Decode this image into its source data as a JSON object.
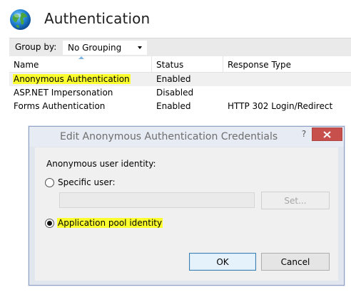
{
  "header": {
    "title": "Authentication",
    "icon": "globe-icon"
  },
  "group_by": {
    "label": "Group by:",
    "value": "No Grouping"
  },
  "list": {
    "columns": [
      "Name",
      "Status",
      "Response Type"
    ],
    "rows": [
      {
        "name": "Anonymous Authentication",
        "status": "Enabled",
        "type": ""
      },
      {
        "name": "ASP.NET Impersonation",
        "status": "Disabled",
        "type": ""
      },
      {
        "name": "Forms Authentication",
        "status": "Enabled",
        "type": "HTTP 302 Login/Redirect"
      }
    ]
  },
  "dialog": {
    "title": "Edit Anonymous Authentication Credentials",
    "help_label": "?",
    "group_label": "Anonymous user identity:",
    "specific_user_label": "Specific user:",
    "specific_user_value": "",
    "set_button": "Set...",
    "app_pool_label": "Application pool identity",
    "selected_option": "Application pool identity",
    "ok_button": "OK",
    "cancel_button": "Cancel"
  },
  "colors": {
    "highlight": "#fbff2e",
    "close_button": "#c7504d",
    "dialog_frame": "#e1e6ef"
  }
}
